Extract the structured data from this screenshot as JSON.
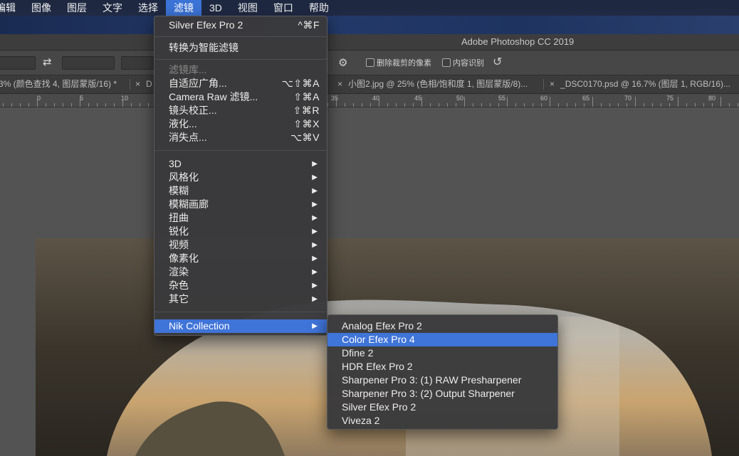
{
  "menubar": {
    "items": [
      "编辑",
      "图像",
      "图层",
      "文字",
      "选择",
      "滤镜",
      "3D",
      "视图",
      "窗口",
      "帮助"
    ],
    "active_index": 5
  },
  "window": {
    "title": "Adobe Photoshop CC 2019"
  },
  "options": {
    "delete_cropped_label": "删除裁剪的像素",
    "content_aware_label": "内容识别"
  },
  "tabs": [
    {
      "label": "3% (颜色查找 4, 图层蒙版/16) *",
      "close": "×"
    },
    {
      "label": "D",
      "close": "×"
    },
    {
      "label": "小图2.jpg @ 25% (色相/饱和度 1, 图层蒙版/8)...",
      "close": "×"
    },
    {
      "label": "_DSC0170.psd @ 16.7% (图层 1, RGB/16)...",
      "close": "×"
    }
  ],
  "ruler": {
    "labels": [
      "0",
      "5",
      "10",
      "35",
      "40",
      "45",
      "50",
      "55",
      "60",
      "65",
      "70",
      "75",
      "80"
    ]
  },
  "filter_menu": {
    "items": [
      {
        "label": "Silver Efex Pro 2",
        "shortcut": "^⌘F"
      },
      {
        "label": "转换为智能滤镜"
      },
      {
        "label": "滤镜库...",
        "disabled": true
      },
      {
        "label": "自适应广角...",
        "shortcut": "⌥⇧⌘A"
      },
      {
        "label": "Camera Raw 滤镜...",
        "shortcut": "⇧⌘A"
      },
      {
        "label": "镜头校正...",
        "shortcut": "⇧⌘R"
      },
      {
        "label": "液化...",
        "shortcut": "⇧⌘X"
      },
      {
        "label": "消失点...",
        "shortcut": "⌥⌘V"
      },
      {
        "label": "3D",
        "submenu": true
      },
      {
        "label": "风格化",
        "submenu": true
      },
      {
        "label": "模糊",
        "submenu": true
      },
      {
        "label": "模糊画廊",
        "submenu": true
      },
      {
        "label": "扭曲",
        "submenu": true
      },
      {
        "label": "锐化",
        "submenu": true
      },
      {
        "label": "视频",
        "submenu": true
      },
      {
        "label": "像素化",
        "submenu": true
      },
      {
        "label": "渲染",
        "submenu": true
      },
      {
        "label": "杂色",
        "submenu": true
      },
      {
        "label": "其它",
        "submenu": true
      },
      {
        "label": "Nik Collection",
        "submenu": true,
        "highlighted": true
      }
    ]
  },
  "nik_submenu": {
    "items": [
      {
        "label": "Analog Efex Pro 2"
      },
      {
        "label": "Color Efex Pro 4",
        "highlighted": true
      },
      {
        "label": "Dfine 2"
      },
      {
        "label": "HDR Efex Pro 2"
      },
      {
        "label": "Sharpener Pro 3: (1) RAW Presharpener"
      },
      {
        "label": "Sharpener Pro 3: (2) Output Sharpener"
      },
      {
        "label": "Silver Efex Pro 2"
      },
      {
        "label": "Viveza 2"
      }
    ]
  },
  "colors": {
    "highlight": "#3f74d8",
    "menu_bg": "#3a3a3c",
    "app_bg": "#535353"
  }
}
